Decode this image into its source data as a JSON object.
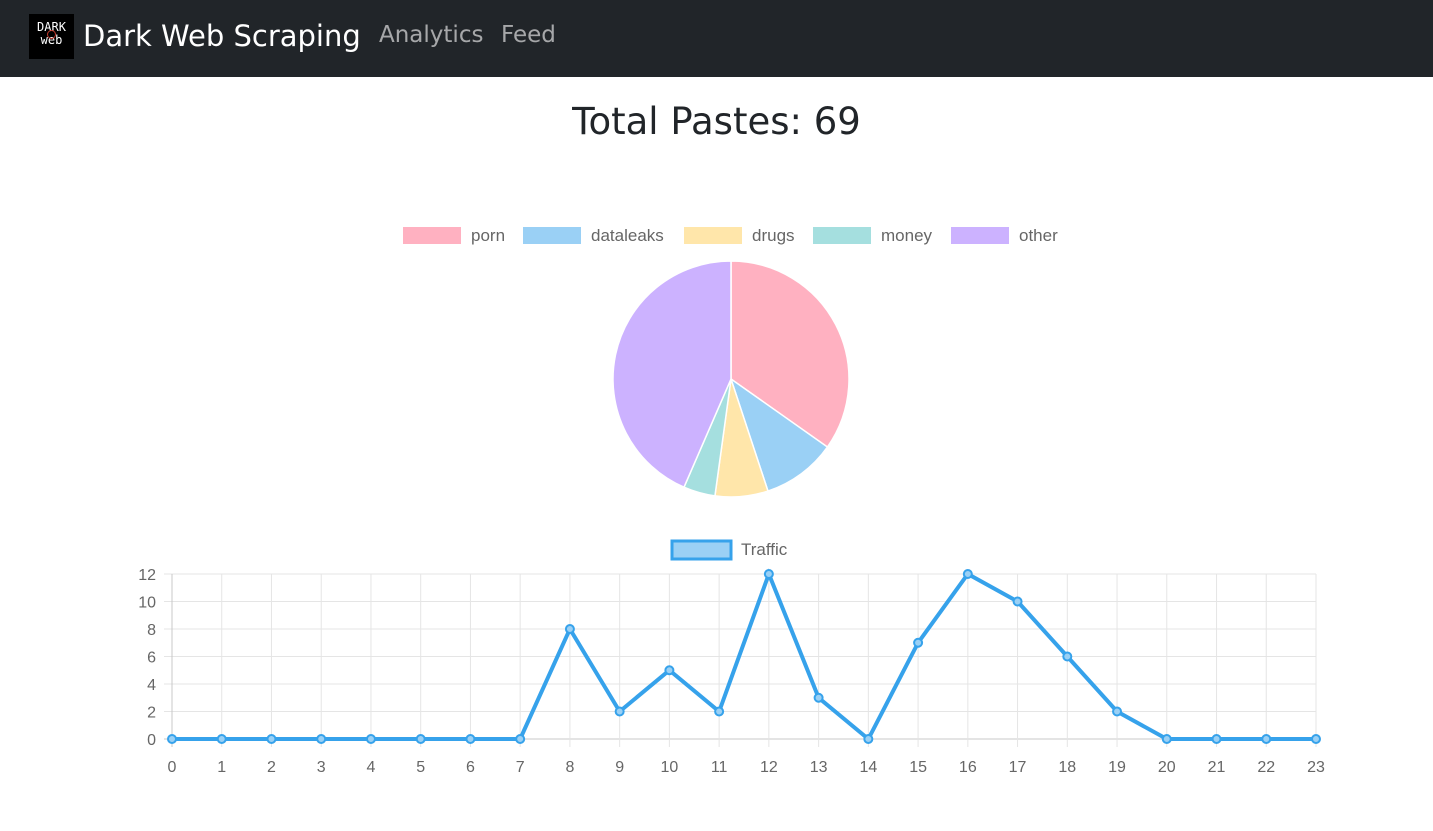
{
  "navbar": {
    "logo_text_top": "DARK",
    "logo_text_bottom": "web",
    "brand": "Dark Web Scraping",
    "links": [
      "Analytics",
      "Feed"
    ]
  },
  "page": {
    "title": "Total Pastes: 69"
  },
  "chart_data": [
    {
      "type": "pie",
      "categories": [
        "porn",
        "dataleaks",
        "drugs",
        "money",
        "other"
      ],
      "values": [
        24,
        7,
        5,
        3,
        30
      ],
      "colors": [
        "#ffb1c1",
        "#9ad0f5",
        "#ffe6aa",
        "#a5dfdf",
        "#ccb2ff"
      ],
      "legend_position": "top"
    },
    {
      "type": "line",
      "series": [
        {
          "name": "Traffic",
          "values": [
            0,
            0,
            0,
            0,
            0,
            0,
            0,
            0,
            8,
            2,
            5,
            2,
            12,
            3,
            0,
            7,
            12,
            10,
            6,
            2,
            0,
            0,
            0,
            0
          ],
          "color": "#36a2eb",
          "fill_color": "#9ad0f5"
        }
      ],
      "x": [
        0,
        1,
        2,
        3,
        4,
        5,
        6,
        7,
        8,
        9,
        10,
        11,
        12,
        13,
        14,
        15,
        16,
        17,
        18,
        19,
        20,
        21,
        22,
        23
      ],
      "ylim": [
        0,
        12
      ],
      "yticks": [
        0,
        2,
        4,
        6,
        8,
        10,
        12
      ],
      "grid": true,
      "legend_position": "top"
    }
  ]
}
